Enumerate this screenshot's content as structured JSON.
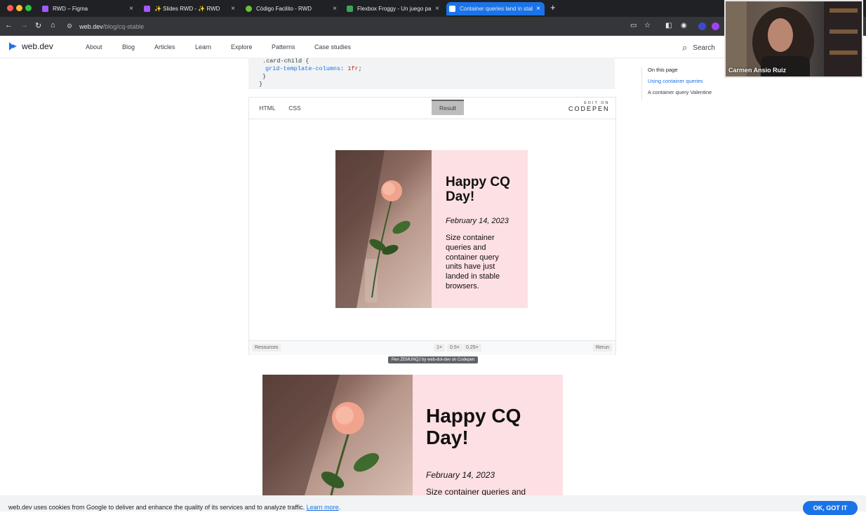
{
  "browser": {
    "tabs": [
      {
        "title": "RWD – Figma",
        "favicon_color": "#a259ff"
      },
      {
        "title": "✨ Slides RWD - ✨ RWD",
        "favicon_color": "#a259ff"
      },
      {
        "title": "Código Facilito - RWD",
        "favicon_color": "#6abf3b"
      },
      {
        "title": "Flexbox Froggy - Un juego pa",
        "favicon_color": "#3aa55a"
      },
      {
        "title": "Container queries land in stab",
        "favicon_color": "#1a73e8"
      }
    ],
    "url_host": "web.dev",
    "url_path": "/blog/cq-stable"
  },
  "site": {
    "logo_text": "web.dev",
    "nav": [
      "About",
      "Blog",
      "Articles",
      "Learn",
      "Explore",
      "Patterns",
      "Case studies"
    ],
    "search_label": "Search"
  },
  "code": {
    "line1": ".card-child {",
    "prop": "grid-template-columns",
    "value": "1fr",
    "line3": "}",
    "line4": "}"
  },
  "embed": {
    "tabs": {
      "html": "HTML",
      "css": "CSS",
      "result": "Result"
    },
    "codepen_edit": "EDIT ON",
    "codepen_logo": "CODEPEN",
    "footer": {
      "resources": "Resources",
      "zoom": [
        "1×",
        "0.5×",
        "0.25×"
      ],
      "rerun": "Rerun"
    },
    "caption": "Pen ZEMUNQJ by web-dot-dev on Codepen"
  },
  "card": {
    "title": "Happy CQ Day!",
    "date": "February 14, 2023",
    "body": "Size container queries and container query units have just landed in stable browsers.",
    "body_short": "Size container queries and"
  },
  "toc": {
    "heading": "On this page",
    "items": [
      "Using container queries",
      "A container query Valentine"
    ]
  },
  "webcam": {
    "name": "Carmen Ansio Ruiz"
  },
  "cookie": {
    "text": "web.dev uses cookies from Google to deliver and enhance the quality of its services and to analyze traffic.",
    "link": "Learn more",
    "button": "OK, GOT IT"
  }
}
